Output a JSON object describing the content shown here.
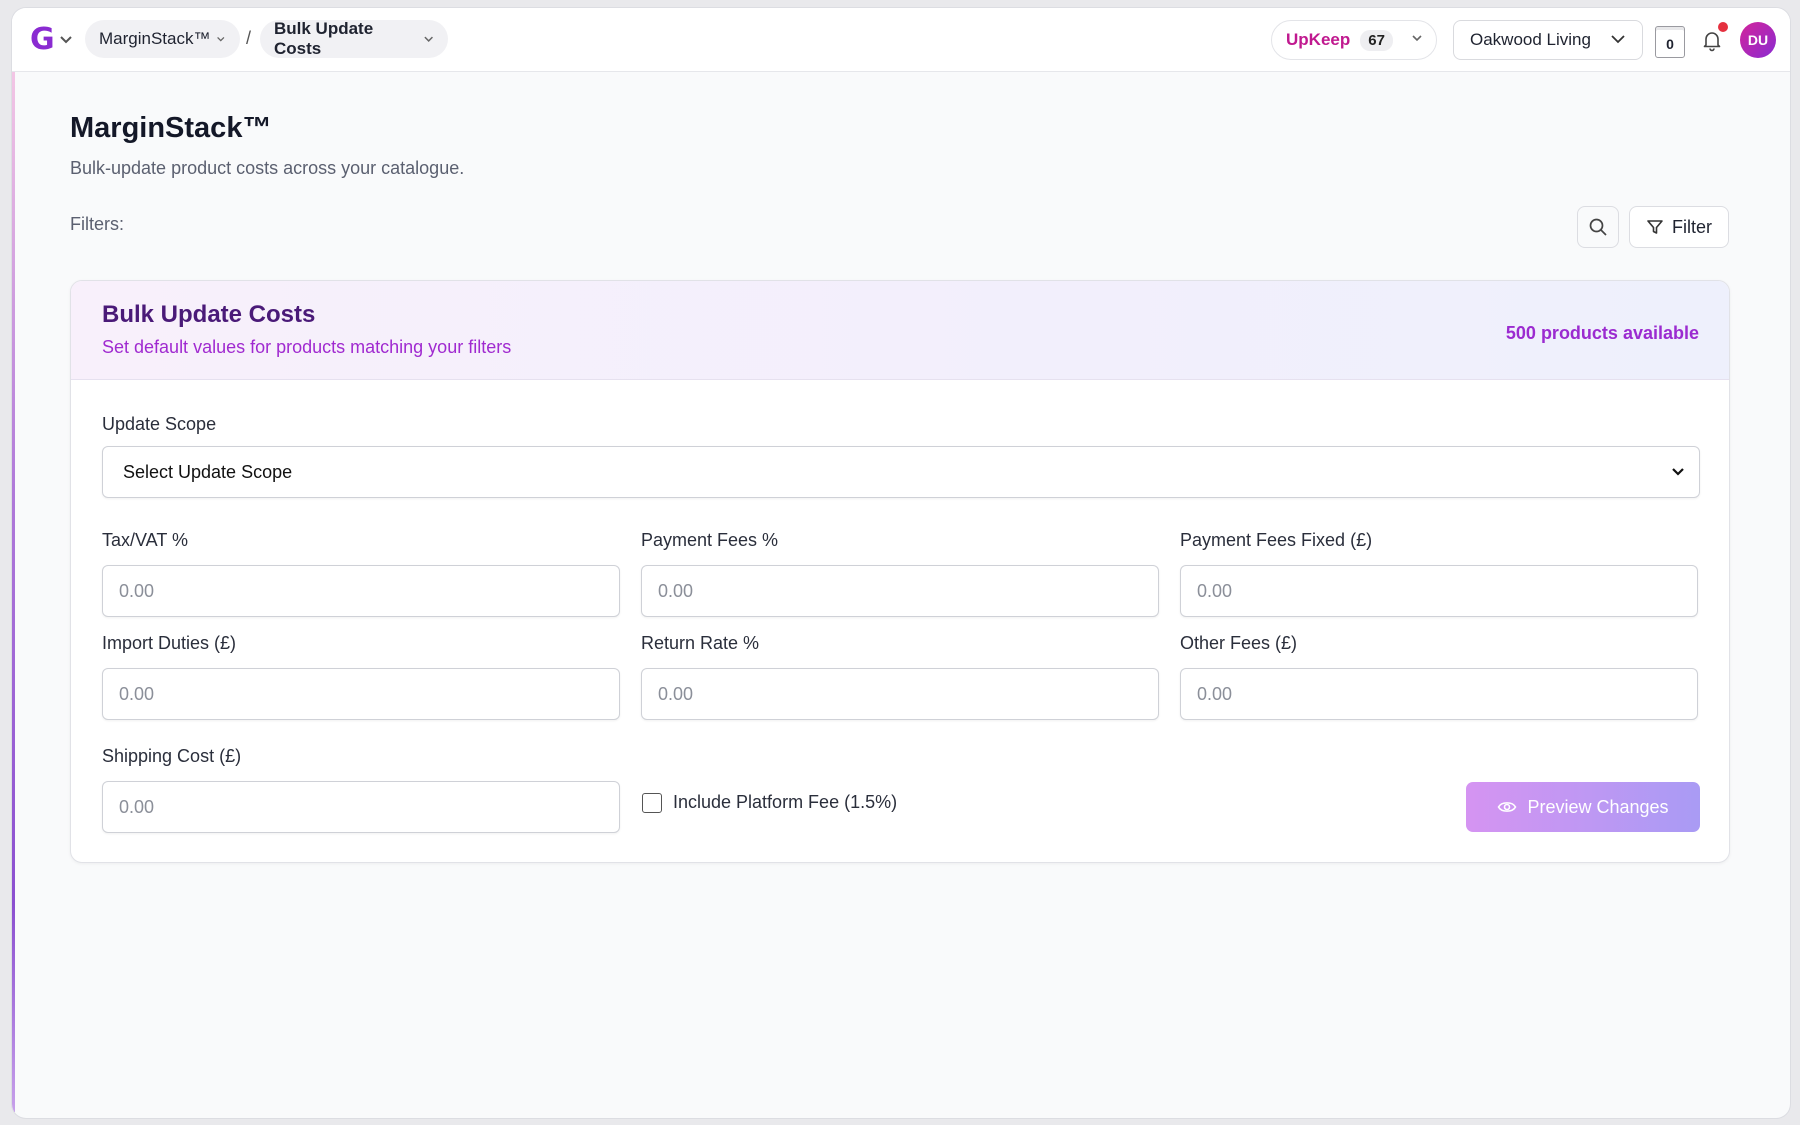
{
  "topbar": {
    "logo_letter": "G",
    "breadcrumb": [
      "MarginStack™",
      "Bulk Update Costs"
    ],
    "separator": "/",
    "upkeep_label": "UpKeep",
    "upkeep_count": "67",
    "store": "Oakwood Living",
    "counter": "0",
    "avatar_initials": "DU",
    "accent": "#8a2bd1"
  },
  "page": {
    "title": "MarginStack™",
    "subtitle": "Bulk-update product costs across your catalogue.",
    "filters_label": "Filters:",
    "filter_button": "Filter"
  },
  "card": {
    "title": "Bulk Update Costs",
    "subtitle": "Set default values for products matching your filters",
    "products_count": "500 products available",
    "scope": {
      "label": "Update Scope",
      "value": "Select Update Scope"
    },
    "fields": [
      {
        "label": "Tax/VAT %",
        "placeholder": "0.00"
      },
      {
        "label": "Payment Fees %",
        "placeholder": "0.00"
      },
      {
        "label": "Payment Fees Fixed (£)",
        "placeholder": "0.00"
      },
      {
        "label": "Import Duties (£)",
        "placeholder": "0.00"
      },
      {
        "label": "Return Rate %",
        "placeholder": "0.00"
      },
      {
        "label": "Other Fees (£)",
        "placeholder": "0.00"
      },
      {
        "label": "Shipping Cost (£)",
        "placeholder": "0.00"
      }
    ],
    "platform_fee_label": "Include Platform Fee (1.5%)",
    "platform_fee_checked": false,
    "preview_button": "Preview Changes"
  }
}
